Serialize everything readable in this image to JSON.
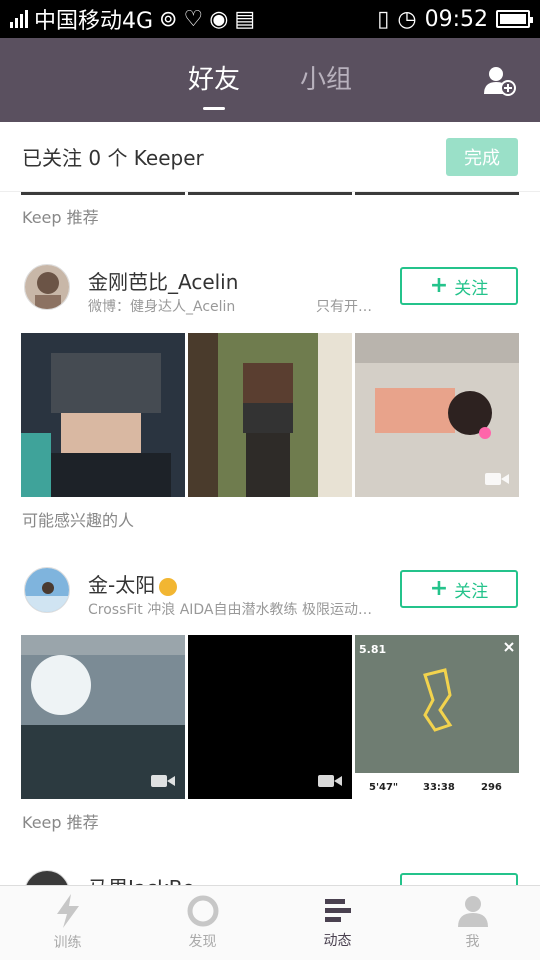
{
  "status": {
    "carrier": "中国移动4G",
    "time": "09:52"
  },
  "nav": {
    "tabs": [
      "好友",
      "小组"
    ],
    "active": 0
  },
  "header": {
    "follow_text": "已关注 0 个 Keeper",
    "done_label": "完成"
  },
  "feed": {
    "label1": "Keep 推荐",
    "user1": {
      "name": "金刚芭比_Acelin",
      "sub1": "微博：健身达人_Acelin",
      "sub2": "只有开…",
      "follow": "关注"
    },
    "label2": "可能感兴趣的人",
    "user2": {
      "name": "金-太阳",
      "sub": "CrossFit 冲浪 AIDA自由潜水教练 极限运动…",
      "follow": "关注"
    },
    "label3": "Keep 推荐",
    "user3": {
      "name": "马里JackBo"
    },
    "stats": {
      "distance": "5.81",
      "pace": "5'47\"",
      "duration": "33:38",
      "calories": "296"
    }
  },
  "tabbar": {
    "items": [
      "训练",
      "发现",
      "动态",
      "我"
    ],
    "active": 2
  },
  "colors": {
    "accent": "#24c38b",
    "nav_bg": "#5a505f",
    "done_bg": "#9ae0c8"
  }
}
